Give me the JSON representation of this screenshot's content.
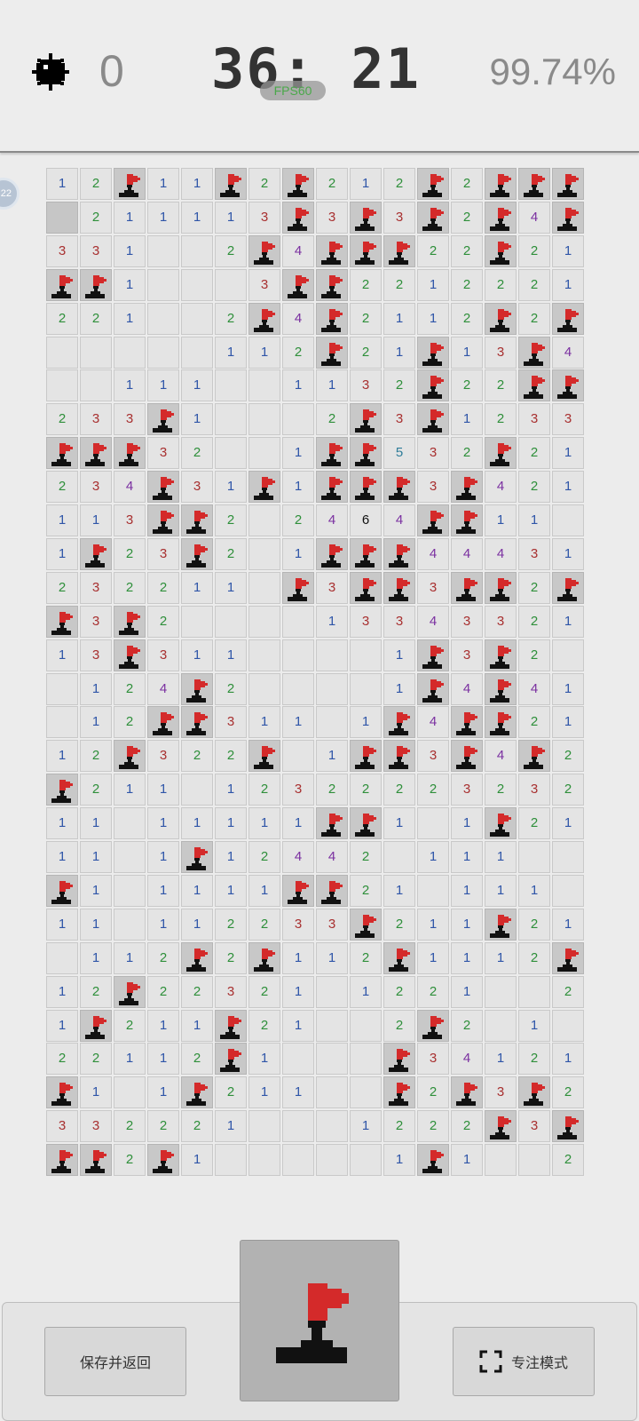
{
  "header": {
    "mine_icon": "mine-icon",
    "mines_remaining": "0",
    "timer": "36: 21",
    "fps_badge": "FPS60",
    "progress": "99.74%",
    "side_bubble": "22"
  },
  "board": {
    "cols": 16,
    "rows": 30,
    "legend": "F = flagged, 0 = revealed empty, X = unrevealed, digits = adjacent mines",
    "grid": [
      "12F11F2F212F2FFF",
      "X211113F3F3F2F4F",
      "331002F4FFF22F21",
      "FF10003FF2212221",
      "221002F4F2112F2F",
      "00000112F21F13F4",
      "00111001132F22FF",
      "233F10002F3F1233",
      "FFF32001FF532F21",
      "234F31F1FFF3F421",
      "113FF202464FF110",
      "1F23F201FFF44431",
      "2322110F3FF3FF2F",
      "F3F2000013343321",
      "13F31100001F3F20",
      "0124F200001F4F41",
      "012FF31101F4FF21",
      "12F322F01FF3F4F2",
      "F211012322223232",
      "11011111FF101F21",
      "1101F12442011100",
      "F101111FF2101110",
      "110112233F211F21",
      "0112F2F112F1112F",
      "12F22321012210022",
      "1F211F21002F2010F",
      "22112F1000F34121",
      "F101F21100F2F3F21",
      "3322210001222F3F3",
      "FF2F1000001F1002FF"
    ]
  },
  "controls": {
    "save_label": "保存并返回",
    "focus_label": "专注模式",
    "flag_mode_icon": "flag-icon",
    "focus_icon": "focus-frame-icon"
  },
  "colors": {
    "n1": "#2f55a8",
    "n2": "#2e8f3a",
    "n3": "#a83030",
    "n4": "#7a2fa0",
    "n5": "#2f7d9a",
    "n6": "#111111",
    "flag_red": "#d42a2a"
  }
}
